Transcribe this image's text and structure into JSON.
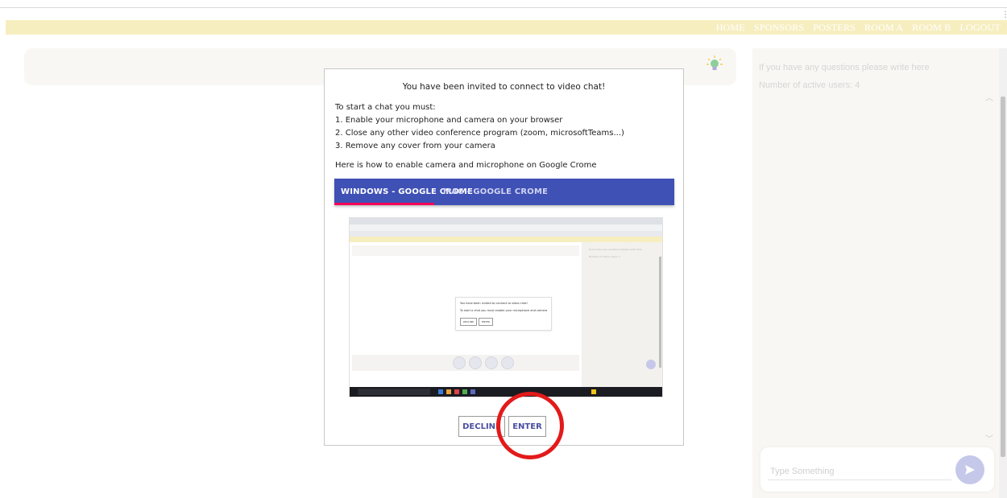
{
  "nav": {
    "items": [
      "HOME",
      "SPONSORS",
      "POSTERS",
      "ROOM A",
      "ROOM B",
      "LOGOUT"
    ]
  },
  "chat": {
    "question_prompt": "If you have any questions please write here",
    "active_users": "Number of active users: 4",
    "input_placeholder": "Type Something",
    "icons": {
      "send": "send-icon",
      "chevron_up": "chevron-up-icon",
      "chevron_down": "chevron-down-icon"
    }
  },
  "main": {
    "icon": "lightbulb-icon"
  },
  "modal": {
    "title": "You have been invited to connect to video chat!",
    "intro": "To start a chat you must:",
    "steps": [
      "1. Enable your microphone and camera on your browser",
      "2. Close any other video conference program (zoom, microsoftTeams...)",
      "3. Remove any cover from your camera"
    ],
    "howto": "Here is how to enable camera and microphone on Google Crome",
    "tabs": [
      {
        "label": "WINDOWS - GOOGLE CROME",
        "active": true
      },
      {
        "label": "MAC - GOOGLE CROME",
        "active": false
      }
    ],
    "screenshot": {
      "side_text_1": "If you have any questions please write here",
      "side_text_2": "Number of active users: 1",
      "dialog_title": "You have been invited to connect to video chat!",
      "dialog_text": "To start a chat you must enable your microphone and camera",
      "decline": "DECLINE",
      "enter": "ENTER"
    },
    "buttons": {
      "decline": "DECLINE",
      "enter": "ENTER"
    }
  },
  "colors": {
    "navbar": "#f7eec0",
    "tab_bar": "#3f51b5",
    "tab_indicator": "#f50057",
    "highlight_circle": "#e31a1a"
  }
}
